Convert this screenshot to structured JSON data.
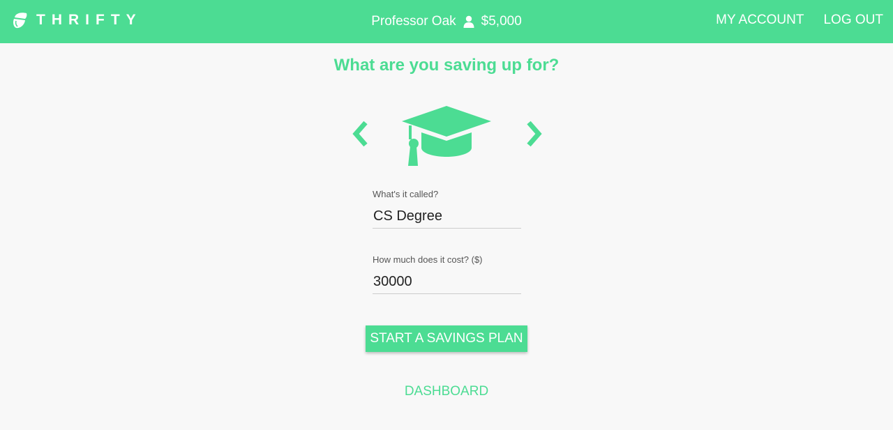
{
  "header": {
    "brand_name": "THRIFTY",
    "user_name": "Professor Oak",
    "balance": "$5,000",
    "links": {
      "account": "MY ACCOUNT",
      "logout": "LOG OUT"
    }
  },
  "main": {
    "heading": "What are you saving up for?",
    "selected_icon": "graduation-cap-icon",
    "fields": {
      "name": {
        "label": "What's it called?",
        "value": "CS Degree"
      },
      "cost": {
        "label": "How much does it cost? ($)",
        "value": "30000"
      }
    },
    "start_button_label": "START A SAVINGS PLAN",
    "dashboard_link": "DASHBOARD"
  },
  "colors": {
    "accent": "#4cdc93",
    "background": "#f8f8f8",
    "text": "#222222"
  }
}
